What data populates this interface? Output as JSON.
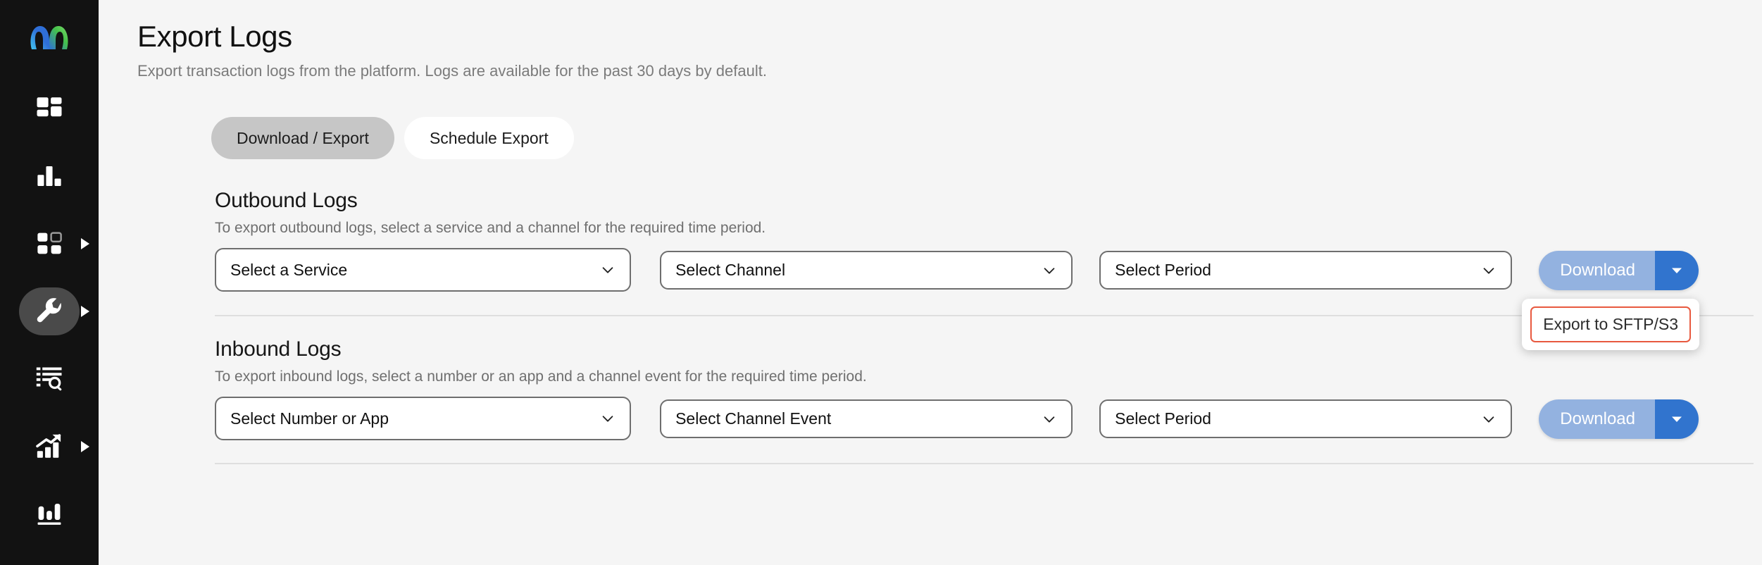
{
  "sidebar": {
    "logo": {
      "icon": "infinity-loop-logo",
      "colors": [
        "#3fb8ef",
        "#2f6fd8",
        "#45c24a"
      ]
    },
    "items": [
      {
        "id": "dashboard",
        "icon": "dashboard-grid-icon",
        "active": false,
        "expandable": false
      },
      {
        "id": "analytics",
        "icon": "bar-chart-icon",
        "active": false,
        "expandable": false
      },
      {
        "id": "apps",
        "icon": "apps-grid-icon",
        "active": false,
        "expandable": true
      },
      {
        "id": "tools",
        "icon": "wrench-icon",
        "active": true,
        "expandable": true
      },
      {
        "id": "logs",
        "icon": "list-search-icon",
        "active": false,
        "expandable": false
      },
      {
        "id": "reports",
        "icon": "trending-up-icon",
        "active": false,
        "expandable": true
      },
      {
        "id": "insights",
        "icon": "bar-chart-underline-icon",
        "active": false,
        "expandable": false
      }
    ]
  },
  "header": {
    "title": "Export Logs",
    "subtitle": "Export transaction logs from the platform. Logs are available for the past 30 days by default."
  },
  "tabs": [
    {
      "id": "download-export",
      "label": "Download / Export",
      "active": true
    },
    {
      "id": "schedule-export",
      "label": "Schedule Export",
      "active": false
    }
  ],
  "outbound": {
    "title": "Outbound Logs",
    "description": "To export outbound logs, select a service and a channel for the required time period.",
    "fields": [
      {
        "id": "service",
        "value": "Select a Service"
      },
      {
        "id": "channel",
        "value": "Select Channel"
      },
      {
        "id": "period",
        "value": "Select Period"
      }
    ],
    "download": {
      "label": "Download",
      "caret_icon": "chevron-down-icon"
    },
    "menu": {
      "open": true,
      "items": [
        {
          "id": "export-sftp-s3",
          "label": "Export to SFTP/S3"
        }
      ]
    }
  },
  "inbound": {
    "title": "Inbound Logs",
    "description": "To export inbound logs, select a number or an app and a channel event for the required time period.",
    "fields": [
      {
        "id": "number-or-app",
        "value": "Select Number or App"
      },
      {
        "id": "channel-event",
        "value": "Select Channel Event"
      },
      {
        "id": "period",
        "value": "Select Period"
      }
    ],
    "download": {
      "label": "Download",
      "caret_icon": "chevron-down-icon"
    }
  },
  "colors": {
    "sidebar_bg": "#121212",
    "page_bg": "#f5f5f5",
    "accent_blue": "#3174ce",
    "disabled_blue": "#93b2e0",
    "menu_outline": "#e8593f",
    "tab_active_bg": "#c6c6c6"
  }
}
